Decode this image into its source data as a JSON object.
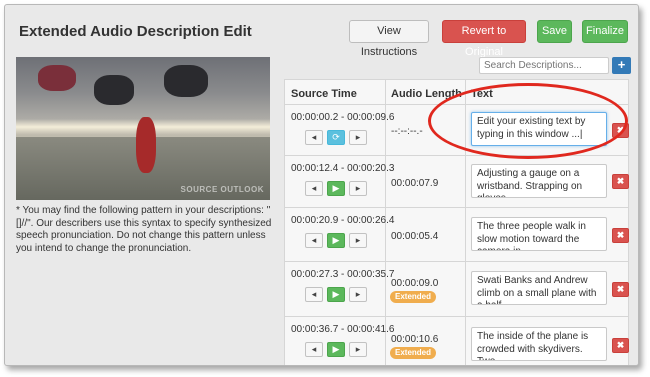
{
  "header": {
    "title": "Extended Audio Description Edit",
    "view_instructions": "View Instructions",
    "revert": "Revert to Original",
    "save": "Save",
    "finalize": "Finalize"
  },
  "search": {
    "placeholder": "Search Descriptions..."
  },
  "video": {
    "watermark": "SOURCE OUTLOOK"
  },
  "note": "* You may find the following pattern in your descriptions: \"[]//\". Our describers use this syntax to specify synthesized speech pronunciation. Do not change this pattern unless you intend to change the pronunciation.",
  "table": {
    "headers": {
      "source_time": "Source Time",
      "audio_length": "Audio Length",
      "text": "Text"
    },
    "rows": [
      {
        "source_time": "00:00:00.2 - 00:00:09.6",
        "audio_length": "--:--:--.-",
        "extended": "",
        "text": "Edit your existing text by typing in this window ...|"
      },
      {
        "source_time": "00:00:12.4 - 00:00:20.3",
        "audio_length": "00:00:07.9",
        "extended": "",
        "text": "Adjusting a gauge on a wristband. Strapping on gloves."
      },
      {
        "source_time": "00:00:20.9 - 00:00:26.4",
        "audio_length": "00:00:05.4",
        "extended": "",
        "text": "The three people walk in slow motion toward the camera in"
      },
      {
        "source_time": "00:00:27.3 - 00:00:35.7",
        "audio_length": "00:00:09.0",
        "extended": "Extended",
        "text": "Swati Banks and Andrew climb on a small plane with a half"
      },
      {
        "source_time": "00:00:36.7 - 00:00:41.6",
        "audio_length": "00:00:10.6",
        "extended": "Extended",
        "text": "The inside of the plane is crowded with skydivers. Two"
      }
    ]
  },
  "icons": {
    "back": "◂",
    "play": "▶",
    "replay": "⟳",
    "forward": "▸",
    "delete": "✖",
    "add": "+"
  },
  "colors": {
    "danger": "#d9534f",
    "success": "#5cb85c",
    "primary": "#337ab7",
    "warning": "#f0ad4e",
    "annotation": "#e0281e"
  }
}
